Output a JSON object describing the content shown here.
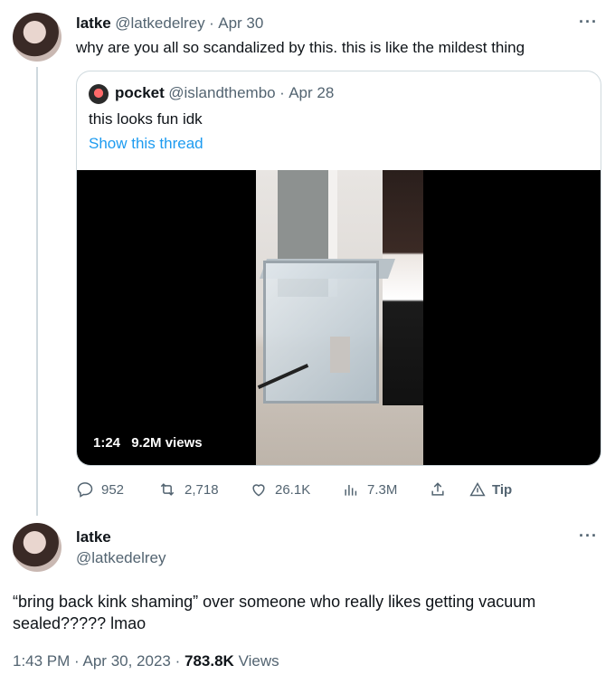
{
  "reply": {
    "display_name": "latke",
    "handle": "@latkedelrey",
    "separator": "·",
    "date": "Apr 30",
    "text": "why are you all so scandalized by this. this is like the mildest thing"
  },
  "quoted": {
    "display_name": "pocket",
    "handle": "@islandthembo",
    "separator": "·",
    "date": "Apr 28",
    "text": "this looks fun idk",
    "show_thread": "Show this thread",
    "video_time": "1:24",
    "video_views": "9.2M views"
  },
  "actions": {
    "replies": "952",
    "retweets": "2,718",
    "likes": "26.1K",
    "views": "7.3M",
    "tip": "Tip"
  },
  "main": {
    "display_name": "latke",
    "handle": "@latkedelrey",
    "text_line1": "“bring back kink shaming” over someone who really likes getting vacuum",
    "text_line2": "sealed????? lmao",
    "time": "1:43 PM",
    "sep1": "·",
    "date": "Apr 30, 2023",
    "sep2": "·",
    "views_count": "783.8K",
    "views_label": "Views"
  },
  "more_glyph": "···",
  "colors": {
    "text": "#0f1419",
    "muted": "#536471",
    "link": "#1d9bf0",
    "border": "#cfd9de"
  },
  "icons": [
    "reply-icon",
    "retweet-icon",
    "like-icon",
    "views-icon",
    "share-icon",
    "tip-icon",
    "more-icon"
  ]
}
